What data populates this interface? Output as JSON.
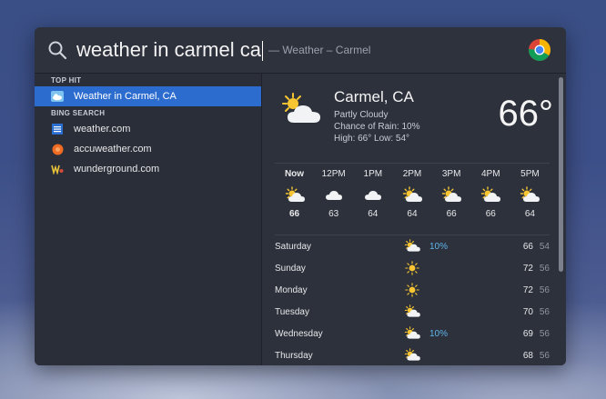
{
  "search": {
    "query": "weather in carmel ca",
    "suffix": "— Weather – Carmel"
  },
  "sections": {
    "top_hit": "TOP HIT",
    "bing_search": "BING SEARCH"
  },
  "results": {
    "top_hit_label": "Weather in Carmel, CA",
    "items": [
      {
        "label": "weather.com",
        "icon": "weather-com-icon"
      },
      {
        "label": "accuweather.com",
        "icon": "accuweather-icon"
      },
      {
        "label": "wunderground.com",
        "icon": "wunderground-icon"
      }
    ]
  },
  "weather": {
    "city": "Carmel, CA",
    "condition": "Partly Cloudy",
    "rain_chance": "Chance of Rain: 10%",
    "high_low": "High: 66°  Low: 54°",
    "current_temp": "66°",
    "hourly": [
      {
        "label": "Now",
        "temp": "66",
        "icon": "partly-cloudy-icon"
      },
      {
        "label": "12PM",
        "temp": "63",
        "icon": "cloudy-icon"
      },
      {
        "label": "1PM",
        "temp": "64",
        "icon": "cloudy-icon"
      },
      {
        "label": "2PM",
        "temp": "64",
        "icon": "partly-cloudy-icon"
      },
      {
        "label": "3PM",
        "temp": "66",
        "icon": "partly-cloudy-icon"
      },
      {
        "label": "4PM",
        "temp": "66",
        "icon": "partly-cloudy-icon"
      },
      {
        "label": "5PM",
        "temp": "64",
        "icon": "partly-cloudy-icon"
      }
    ],
    "daily": [
      {
        "day": "Saturday",
        "rain": "10%",
        "hi": "66",
        "lo": "54",
        "icon": "partly-cloudy-icon"
      },
      {
        "day": "Sunday",
        "rain": "",
        "hi": "72",
        "lo": "56",
        "icon": "sunny-icon"
      },
      {
        "day": "Monday",
        "rain": "",
        "hi": "72",
        "lo": "56",
        "icon": "sunny-icon"
      },
      {
        "day": "Tuesday",
        "rain": "",
        "hi": "70",
        "lo": "56",
        "icon": "partly-cloudy-icon"
      },
      {
        "day": "Wednesday",
        "rain": "10%",
        "hi": "69",
        "lo": "56",
        "icon": "partly-cloudy-icon"
      },
      {
        "day": "Thursday",
        "rain": "",
        "hi": "68",
        "lo": "56",
        "icon": "partly-cloudy-icon"
      }
    ]
  },
  "colors": {
    "selection": "#2c6ccf",
    "rain": "#5fb5ec"
  }
}
